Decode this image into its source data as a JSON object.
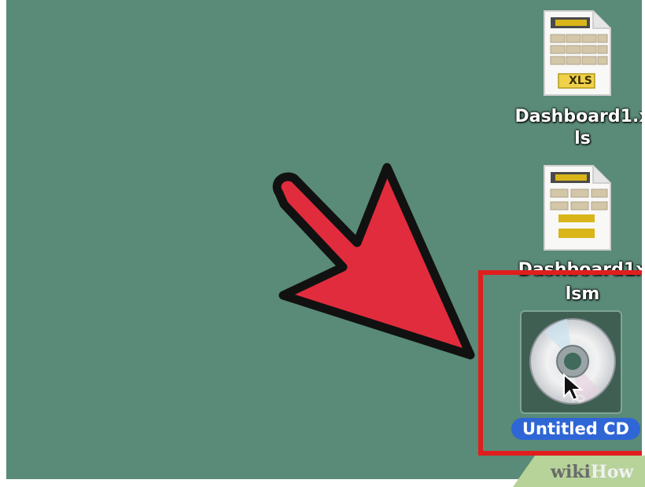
{
  "desktop": {
    "background_color": "#5a8a78",
    "icons": [
      {
        "type": "xls-file",
        "badge": "XLS",
        "label_line1": "Dashboard1.x",
        "label_line2": "ls"
      },
      {
        "type": "xlsm-file",
        "label_line1": "Dashboard1x",
        "label_line2": "lsm"
      },
      {
        "type": "cd-disc",
        "label": "Untitled CD",
        "selected": true
      }
    ]
  },
  "annotations": {
    "arrow_color": "#e12c3d",
    "highlight_color": "#e01e1e",
    "arrow_icon": "red-pointing-arrow-icon"
  },
  "watermark": {
    "part1": "wiki",
    "part2": "How"
  }
}
